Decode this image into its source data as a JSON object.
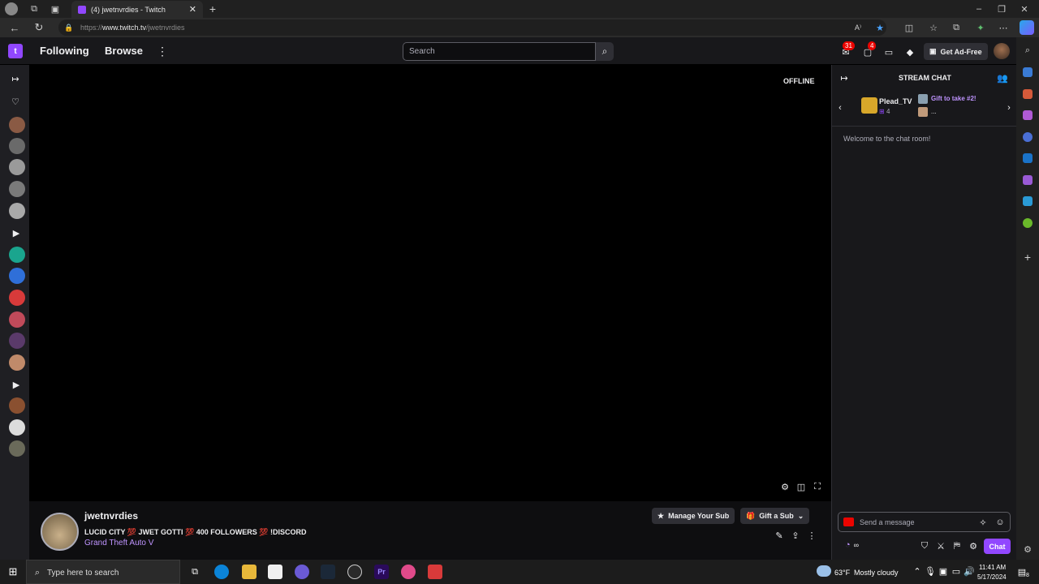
{
  "browser": {
    "tab_title": "(4) jwetnvrdies - Twitch",
    "url_prefix": "https://",
    "url_host": "www.twitch.tv",
    "url_path": "/jwetnvrdies",
    "read_aloud": "A⁾"
  },
  "nav": {
    "following": "Following",
    "browse": "Browse",
    "search_placeholder": "Search",
    "notifications_count": "31",
    "inbox_count": "4",
    "get_ad_free": "Get Ad-Free"
  },
  "player": {
    "offline_label": "OFFLINE"
  },
  "channel": {
    "name": "jwetnvrdies",
    "title": "LUCID CITY 💯 JWET GOTTI 💯  400 FOLLOWERS 💯  !DISCORD",
    "game": "Grand Theft Auto V",
    "manage_sub": "Manage Your Sub",
    "gift_sub": "Gift a Sub"
  },
  "chat": {
    "header": "STREAM CHAT",
    "gifter_name": "Plead_TV",
    "gifter_count": "4",
    "gift_promo": "Gift to take #2!",
    "gift_more": "...",
    "welcome": "Welcome to the chat room!",
    "input_placeholder": "Send a message",
    "points": "∞",
    "chat_button": "Chat"
  },
  "taskbar": {
    "search_placeholder": "Type here to search",
    "temperature": "63°F",
    "weather": "Mostly cloudy",
    "time": "11:41 AM",
    "date": "5/17/2024",
    "notif_count": "8"
  },
  "colors": {
    "twitch_purple": "#9147ff",
    "link_purple": "#bf94ff",
    "badge_red": "#eb0400"
  }
}
